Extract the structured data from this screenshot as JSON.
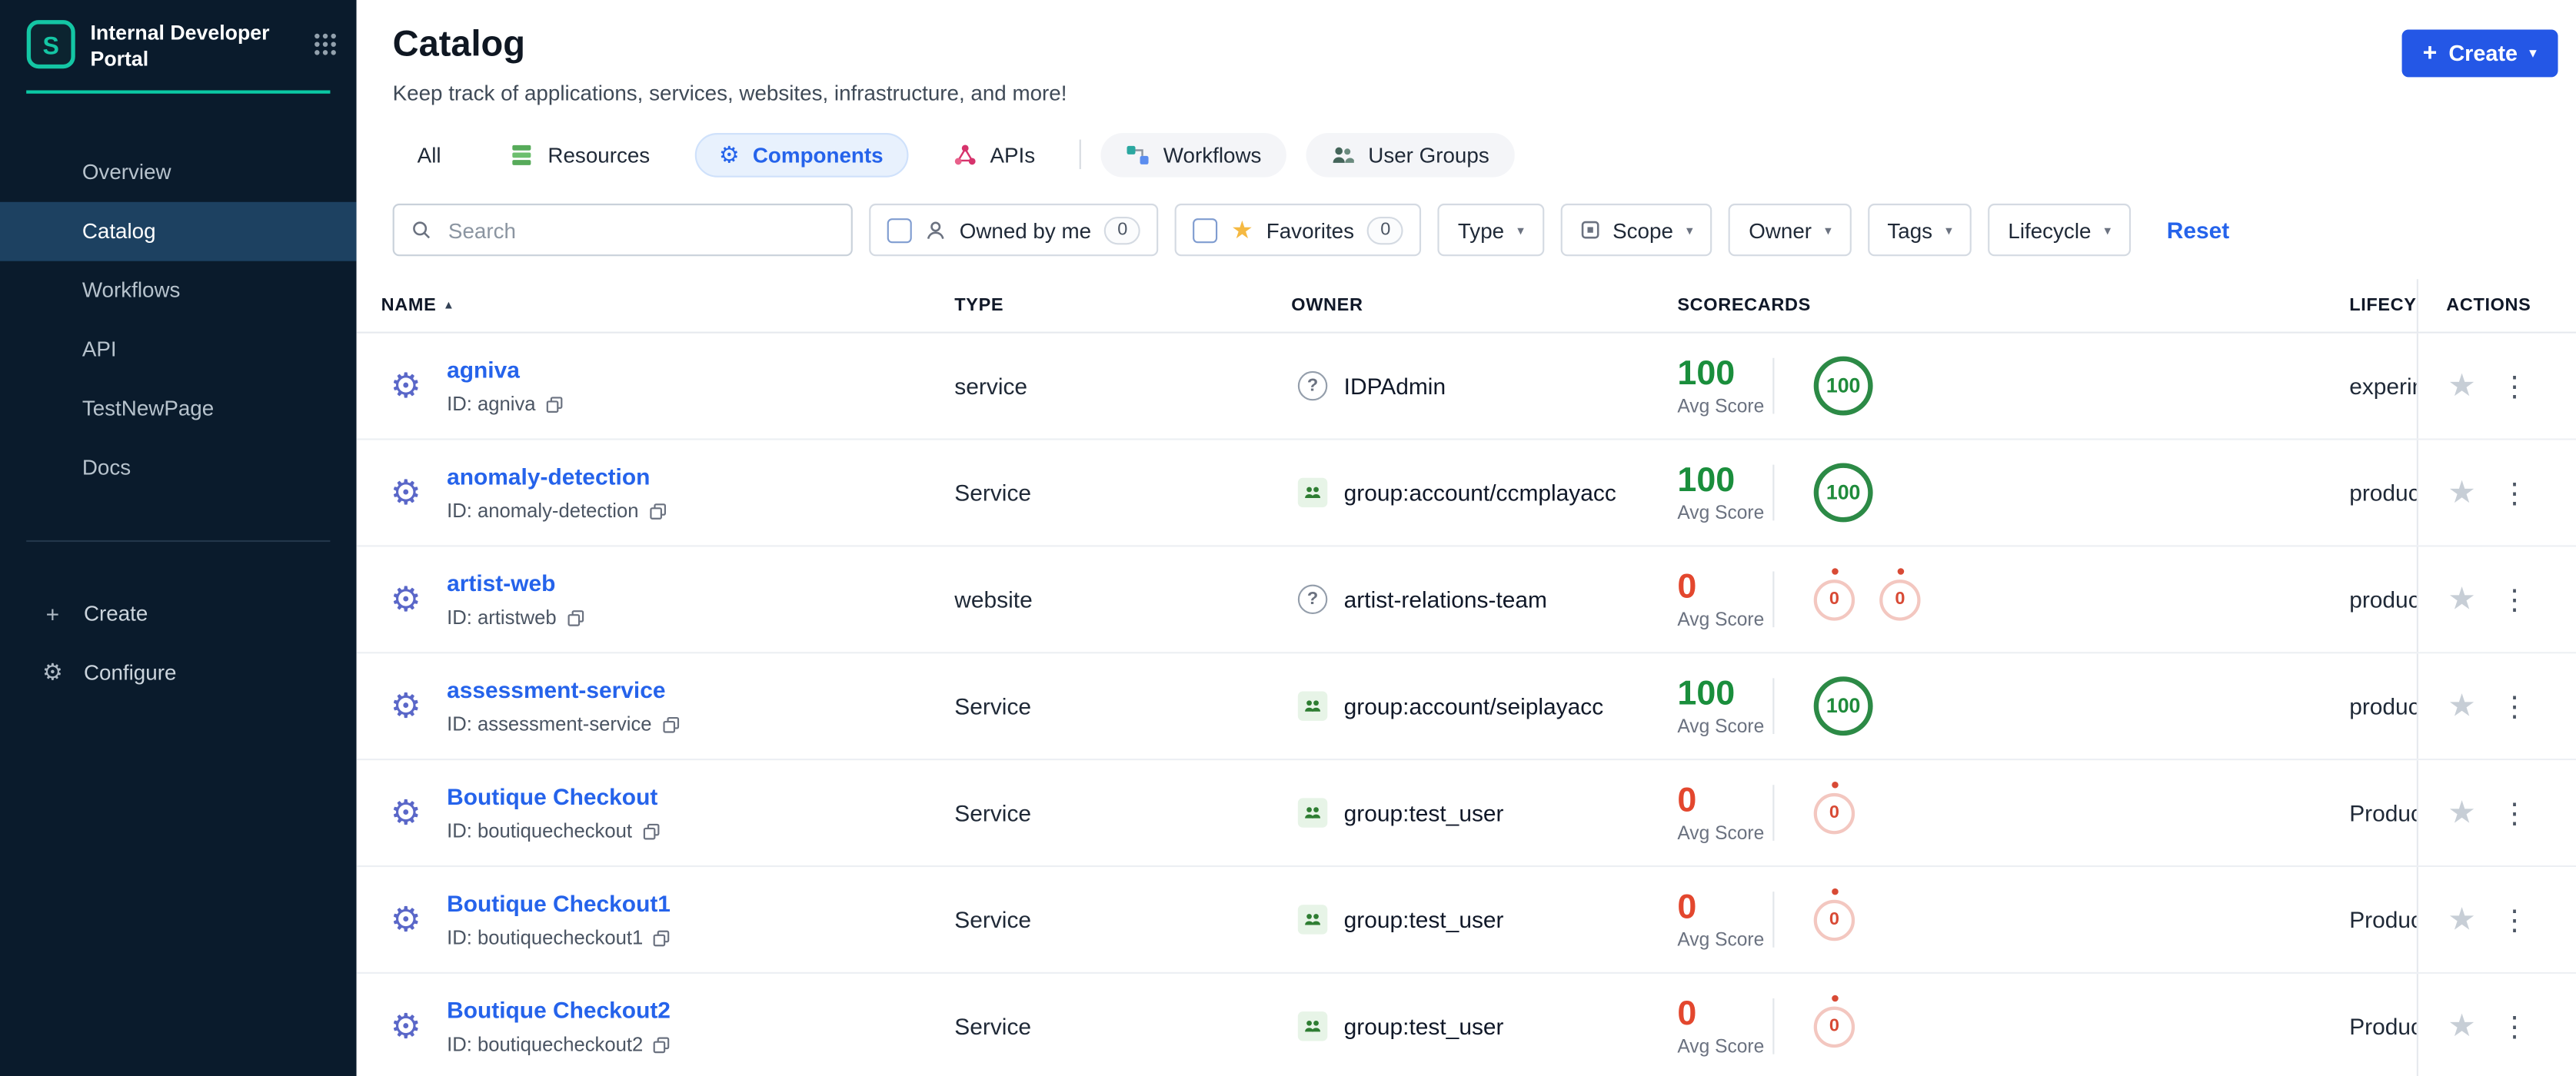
{
  "sidebar": {
    "title": "Internal Developer Portal",
    "items": [
      {
        "label": "Overview",
        "active": false
      },
      {
        "label": "Catalog",
        "active": true
      },
      {
        "label": "Workflows",
        "active": false
      },
      {
        "label": "API",
        "active": false
      },
      {
        "label": "TestNewPage",
        "active": false
      },
      {
        "label": "Docs",
        "active": false
      }
    ],
    "create_label": "Create",
    "configure_label": "Configure"
  },
  "header": {
    "title": "Catalog",
    "subtitle": "Keep track of applications, services, websites, infrastructure, and more!",
    "create_button": "Create"
  },
  "tabs": [
    {
      "label": "All",
      "selected": false
    },
    {
      "label": "Resources",
      "icon": "resources-icon",
      "selected": false
    },
    {
      "label": "Components",
      "icon": "components-gear-icon",
      "selected": true
    },
    {
      "label": "APIs",
      "icon": "apis-icon",
      "selected": false
    },
    {
      "label": "Workflows",
      "icon": "workflows-icon",
      "selected": false
    },
    {
      "label": "User Groups",
      "icon": "user-groups-icon",
      "selected": false
    }
  ],
  "filters": {
    "search_placeholder": "Search",
    "owned_by_me": {
      "label": "Owned by me",
      "count": "0"
    },
    "favorites": {
      "label": "Favorites",
      "count": "0"
    },
    "dropdowns": [
      "Type",
      "Scope",
      "Owner",
      "Tags",
      "Lifecycle"
    ],
    "reset_label": "Reset"
  },
  "table": {
    "columns": [
      "NAME",
      "TYPE",
      "OWNER",
      "SCORECARDS",
      "LIFECYCLE",
      "ACTIONS"
    ],
    "avg_score_label": "Avg Score",
    "rows": [
      {
        "name": "agniva",
        "id": "ID: agniva",
        "type": "service",
        "owner": "IDPAdmin",
        "owner_icon": "question",
        "avg_score": "100",
        "score_color": "green",
        "badges": [
          {
            "value": "100",
            "color": "green"
          }
        ],
        "lifecycle": "experimental"
      },
      {
        "name": "anomaly-detection",
        "id": "ID: anomaly-detection",
        "type": "Service",
        "owner": "group:account/ccmplayacc",
        "owner_icon": "group",
        "avg_score": "100",
        "score_color": "green",
        "badges": [
          {
            "value": "100",
            "color": "green"
          }
        ],
        "lifecycle": "production"
      },
      {
        "name": "artist-web",
        "id": "ID: artistweb",
        "type": "website",
        "owner": "artist-relations-team",
        "owner_icon": "question",
        "avg_score": "0",
        "score_color": "red",
        "badges": [
          {
            "value": "0",
            "color": "red"
          },
          {
            "value": "0",
            "color": "red"
          }
        ],
        "lifecycle": "production"
      },
      {
        "name": "assessment-service",
        "id": "ID: assessment-service",
        "type": "Service",
        "owner": "group:account/seiplayacc",
        "owner_icon": "group",
        "avg_score": "100",
        "score_color": "green",
        "badges": [
          {
            "value": "100",
            "color": "green"
          }
        ],
        "lifecycle": "production"
      },
      {
        "name": "Boutique Checkout",
        "id": "ID: boutiquecheckout",
        "type": "Service",
        "owner": "group:test_user",
        "owner_icon": "group",
        "avg_score": "0",
        "score_color": "red",
        "badges": [
          {
            "value": "0",
            "color": "red"
          }
        ],
        "lifecycle": "Production"
      },
      {
        "name": "Boutique Checkout1",
        "id": "ID: boutiquecheckout1",
        "type": "Service",
        "owner": "group:test_user",
        "owner_icon": "group",
        "avg_score": "0",
        "score_color": "red",
        "badges": [
          {
            "value": "0",
            "color": "red"
          }
        ],
        "lifecycle": "Production"
      },
      {
        "name": "Boutique Checkout2",
        "id": "ID: boutiquecheckout2",
        "type": "Service",
        "owner": "group:test_user",
        "owner_icon": "group",
        "avg_score": "0",
        "score_color": "red",
        "badges": [
          {
            "value": "0",
            "color": "red"
          }
        ],
        "lifecycle": "Production"
      }
    ]
  },
  "colors": {
    "accent_blue": "#2563eb",
    "button_blue": "#2457e6",
    "teal": "#0bc8a4",
    "score_green": "#1a8e3c",
    "score_red": "#e3472e",
    "sidebar_bg": "#0a1b2c"
  }
}
